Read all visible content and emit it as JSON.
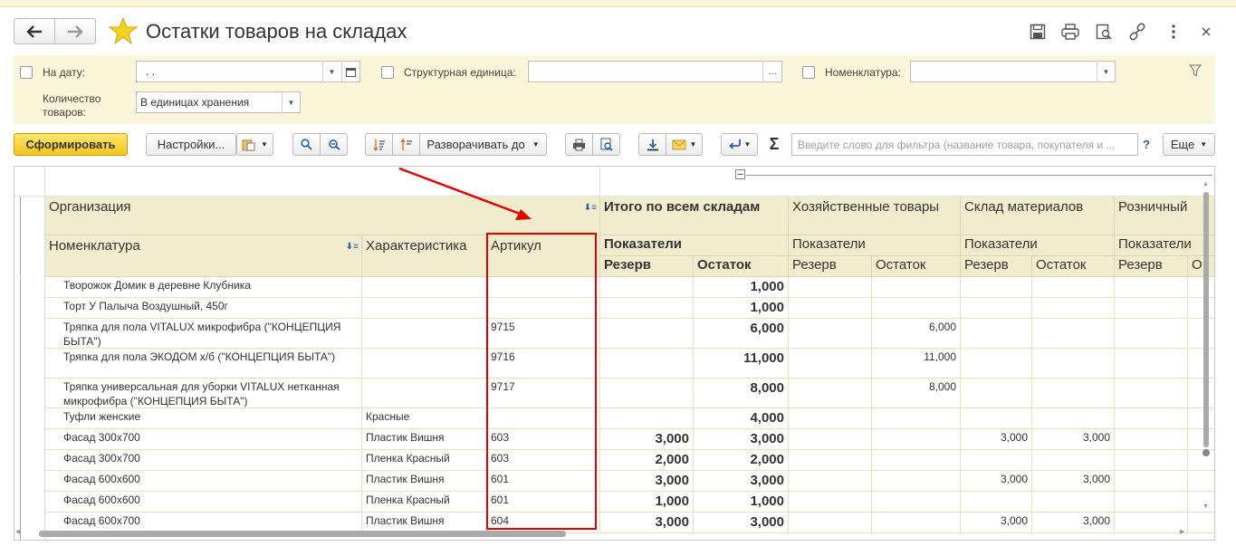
{
  "window": {
    "title": "Остатки товаров на складах",
    "icons": [
      "back-arrow-icon",
      "forward-arrow-icon",
      "star-icon",
      "save-icon",
      "print-icon",
      "preview-icon",
      "link-icon",
      "more-vertical-icon",
      "close-icon"
    ]
  },
  "filters": {
    "date_label": "На дату:",
    "date_value": ". .",
    "unit_label": "Структурная единица:",
    "unit_value": "",
    "unit_button": "...",
    "nomenclature_label": "Номенклатура:",
    "nomenclature_value": "",
    "quantity_label": "Количество товаров:",
    "quantity_value": "В единицах хранения"
  },
  "toolbar": {
    "generate": "Сформировать",
    "settings": "Настройки...",
    "expand_to": "Разворачивать до",
    "search_placeholder": "Введите слово для фильтра (название товара, покупателя и ...",
    "help": "?",
    "more": "Еще",
    "sigma": "Σ"
  },
  "report": {
    "headers": {
      "organization": "Организация",
      "nomenclature": "Номенклатура",
      "characteristic": "Характеристика",
      "article": "Артикул",
      "total": "Итого по всем складам",
      "warehouse_household": "Хозяйственные товары",
      "warehouse_materials": "Склад материалов",
      "warehouse_retail": "Розничный",
      "indicators": "Показатели",
      "reserve": "Резерв",
      "balance": "Остаток",
      "balance_cut": "О"
    },
    "rows": [
      {
        "name": "Творожок Домик в деревне Клубника",
        "char": "",
        "art": "",
        "t_res": "",
        "t_bal": "1,000",
        "h_res": "",
        "h_bal": "",
        "m_res": "",
        "m_bal": ""
      },
      {
        "name": "Торт У Палыча Воздушный, 450г",
        "char": "",
        "art": "",
        "t_res": "",
        "t_bal": "1,000",
        "h_res": "",
        "h_bal": "",
        "m_res": "",
        "m_bal": ""
      },
      {
        "name": "Тряпка для пола VITALUX микрофибра (\"КОНЦЕПЦИЯ БЫТА\")",
        "char": "",
        "art": "9715",
        "t_res": "",
        "t_bal": "6,000",
        "h_res": "",
        "h_bal": "6,000",
        "m_res": "",
        "m_bal": ""
      },
      {
        "name": "Тряпка для пола ЭКОДОМ х/б (\"КОНЦЕПЦИЯ БЫТА\")",
        "char": "",
        "art": "9716",
        "t_res": "",
        "t_bal": "11,000",
        "h_res": "",
        "h_bal": "11,000",
        "m_res": "",
        "m_bal": ""
      },
      {
        "name": "Тряпка универсальная для уборки VITALUX нетканная микрофибра  (\"КОНЦЕПЦИЯ БЫТА\")",
        "char": "",
        "art": "9717",
        "t_res": "",
        "t_bal": "8,000",
        "h_res": "",
        "h_bal": "8,000",
        "m_res": "",
        "m_bal": ""
      },
      {
        "name": "Туфли женские",
        "char": "Красные",
        "art": "",
        "t_res": "",
        "t_bal": "4,000",
        "h_res": "",
        "h_bal": "",
        "m_res": "",
        "m_bal": ""
      },
      {
        "name": "Фасад 300х700",
        "char": "Пластик Вишня",
        "art": "603",
        "t_res": "3,000",
        "t_bal": "3,000",
        "h_res": "",
        "h_bal": "",
        "m_res": "3,000",
        "m_bal": "3,000"
      },
      {
        "name": "Фасад 300х700",
        "char": "Пленка Красный",
        "art": "603",
        "t_res": "2,000",
        "t_bal": "2,000",
        "h_res": "",
        "h_bal": "",
        "m_res": "",
        "m_bal": ""
      },
      {
        "name": "Фасад 600х600",
        "char": "Пластик Вишня",
        "art": "601",
        "t_res": "3,000",
        "t_bal": "3,000",
        "h_res": "",
        "h_bal": "",
        "m_res": "3,000",
        "m_bal": "3,000"
      },
      {
        "name": "Фасад 600х600",
        "char": "Пленка Красный",
        "art": "601",
        "t_res": "1,000",
        "t_bal": "1,000",
        "h_res": "",
        "h_bal": "",
        "m_res": "",
        "m_bal": ""
      },
      {
        "name": "Фасад 600х700",
        "char": "Пластик Вишня",
        "art": "604",
        "t_res": "3,000",
        "t_bal": "3,000",
        "h_res": "",
        "h_bal": "",
        "m_res": "3,000",
        "m_bal": "3,000"
      }
    ]
  },
  "colors": {
    "accent_yellow": "#f4c51d",
    "header_bg": "#f2ecce",
    "filter_bg": "#fbf5d9",
    "highlight_red": "#e00000"
  }
}
